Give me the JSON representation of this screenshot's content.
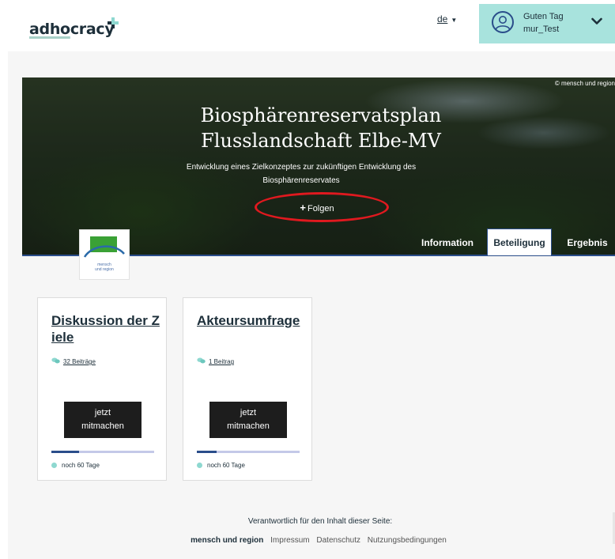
{
  "header": {
    "logo_text_underlined": "adho",
    "logo_text_rest": "cracy",
    "language": "de",
    "user": {
      "greeting": "Guten Tag",
      "username": "mur_Test"
    }
  },
  "hero": {
    "image_credit": "© mensch und region",
    "title_line1": "Biosphärenreservatsplan",
    "title_line2": "Flusslandschaft Elbe-MV",
    "subtitle_line1": "Entwicklung eines Zielkonzeptes zur zukünftigen Entwicklung des",
    "subtitle_line2": "Biosphärenreservates",
    "follow_label": "Folgen",
    "org_logo_text_line1": "mensch",
    "org_logo_text_line2": "und region"
  },
  "tabs": [
    {
      "label": "Information",
      "active": false
    },
    {
      "label": "Beteiligung",
      "active": true
    },
    {
      "label": "Ergebnis",
      "active": false
    }
  ],
  "cards": [
    {
      "title": "Diskussion der Ziele",
      "count": "32 Beiträge",
      "button": "jetzt mitmachen",
      "button_line1": "jetzt",
      "button_line2": "mitmachen",
      "progress": 0.27,
      "remaining": "noch 60 Tage"
    },
    {
      "title": "Akteursumfrage",
      "count": "1 Beitrag",
      "button": "jetzt mitmachen",
      "button_line1": "jetzt",
      "button_line2": "mitmachen",
      "progress": 0.19,
      "remaining": "noch 60 Tage"
    }
  ],
  "footer": {
    "responsible": "Verantwortlich für den Inhalt dieser Seite:",
    "org": "mensch und region",
    "links": [
      "Impressum",
      "Datenschutz",
      "Nutzungsbedingungen"
    ]
  },
  "colors": {
    "accent_teal": "#a8e3dd",
    "brand_blue": "#2a4d8a",
    "highlight_red": "#e0191f",
    "button_dark": "#1d1d1d"
  }
}
